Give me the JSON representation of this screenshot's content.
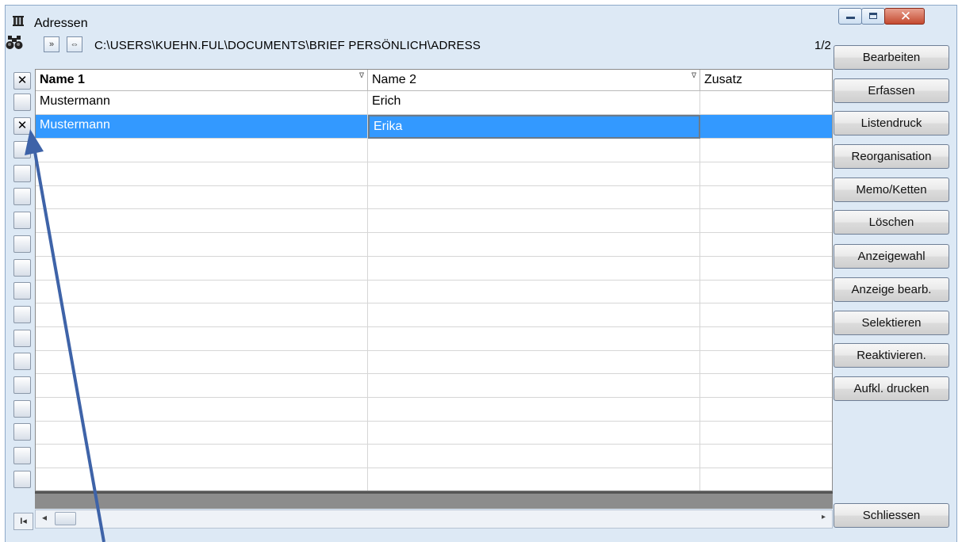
{
  "window": {
    "title": "Adressen",
    "controls": {
      "minimize": "minimize",
      "maximize": "maximize",
      "close": "✕"
    }
  },
  "toolbar": {
    "search_icon": "binoculars-icon",
    "next_label": "»",
    "link_label": "⇔",
    "path": "C:\\USERS\\KUEHN.FUL\\DOCUMENTS\\BRIEF PERSÖNLICH\\ADRESS",
    "page_count": "1/2"
  },
  "table": {
    "select_all_mark": "✕",
    "columns": [
      {
        "label": "Name 1",
        "sort": "∇"
      },
      {
        "label": "Name 2",
        "sort": "∇"
      },
      {
        "label": "Zusatz"
      }
    ],
    "rows": [
      {
        "selected": false,
        "mark": "",
        "cells": [
          "Mustermann",
          "Erich",
          ""
        ]
      },
      {
        "selected": true,
        "mark": "✕",
        "cells": [
          "Mustermann",
          "Erika",
          ""
        ]
      }
    ],
    "empty_row_count": 15,
    "first_record_label": "I◂"
  },
  "sidebar": {
    "buttons": [
      "Bearbeiten",
      "Erfassen",
      "Listendruck",
      "Reorganisation",
      "Memo/Ketten",
      "Löschen",
      "Anzeigewahl",
      "Anzeige bearb.",
      "Selektieren",
      "Reaktivieren.",
      "Aufkl. drucken"
    ],
    "close_button": "Schliessen"
  },
  "colors": {
    "selection": "#3399ff",
    "window_bg": "#dde9f5",
    "annotation_arrow": "#3e63a8"
  }
}
